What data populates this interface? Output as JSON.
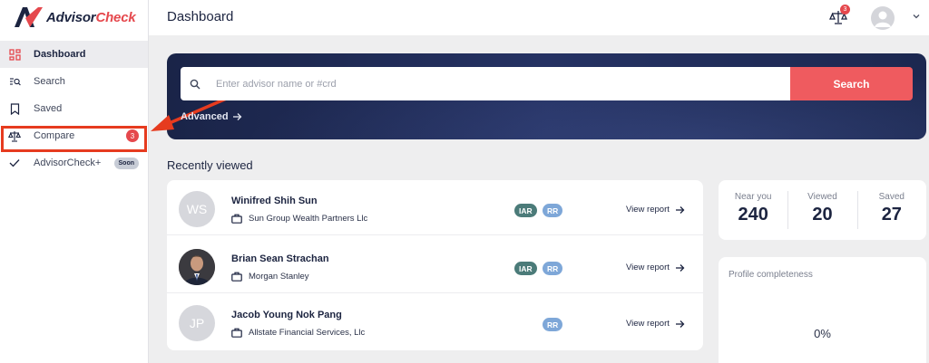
{
  "brand": {
    "name_part1": "Advisor",
    "name_part2": "Check",
    "accent": "#e5484d",
    "navy": "#1c2440"
  },
  "sidebar": {
    "items": [
      {
        "label": "Dashboard",
        "icon": "grid-icon",
        "active": true
      },
      {
        "label": "Search",
        "icon": "search-list-icon"
      },
      {
        "label": "Saved",
        "icon": "bookmark-icon"
      },
      {
        "label": "Compare",
        "icon": "scale-icon",
        "badge": "3"
      },
      {
        "label": "AdvisorCheck+",
        "icon": "check-icon",
        "tag": "Soon"
      }
    ]
  },
  "header": {
    "title": "Dashboard",
    "compare_badge": "3"
  },
  "search": {
    "placeholder": "Enter advisor name or #crd",
    "button": "Search",
    "advanced": "Advanced"
  },
  "recent": {
    "title": "Recently viewed",
    "rows": [
      {
        "initials": "WS",
        "name": "Winifred Shih Sun",
        "firm": "Sun Group Wealth Partners Llc",
        "tags": [
          "IAR",
          "RR"
        ],
        "action": "View report"
      },
      {
        "initials": "",
        "name": "Brian Sean Strachan",
        "firm": "Morgan Stanley",
        "tags": [
          "IAR",
          "RR"
        ],
        "action": "View report"
      },
      {
        "initials": "JP",
        "name": "Jacob Young Nok Pang",
        "firm": "Allstate Financial Services, Llc",
        "tags": [
          "RR"
        ],
        "action": "View report"
      }
    ]
  },
  "stats": [
    {
      "label": "Near you",
      "value": "240"
    },
    {
      "label": "Viewed",
      "value": "20"
    },
    {
      "label": "Saved",
      "value": "27"
    }
  ],
  "profile": {
    "title": "Profile completeness",
    "percent": "0%"
  }
}
